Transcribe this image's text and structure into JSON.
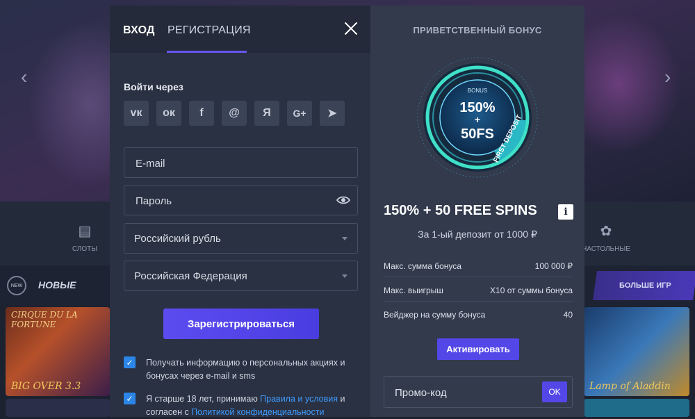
{
  "background": {
    "categories": [
      {
        "label": "СЛОТЫ",
        "icon": "slot-machine-icon"
      },
      {
        "label": "НАСТОЛЬНЫЕ",
        "icon": "poker-chip-icon"
      }
    ],
    "new_badge": "NEW",
    "new_label": "НОВЫЕ",
    "more_games": "БОЛЬШЕ ИГР",
    "game_tiles": [
      {
        "title": "CIRQUE DU LA FORTUNE",
        "bottom": "BIG OVER 3.3"
      },
      {
        "title": "",
        "bottom": "Lamp of Aladdin"
      }
    ]
  },
  "auth": {
    "tabs": [
      {
        "label": "ВХОД",
        "active": false
      },
      {
        "label": "РЕГИСТРАЦИЯ",
        "active": true
      }
    ],
    "login_via": "Войти через",
    "social": [
      {
        "icon": "vk-icon",
        "glyph": "ᴠк"
      },
      {
        "icon": "odnoklassniki-icon",
        "glyph": "ок"
      },
      {
        "icon": "facebook-icon",
        "glyph": "f"
      },
      {
        "icon": "mail-ru-icon",
        "glyph": "@"
      },
      {
        "icon": "yandex-icon",
        "glyph": "Я"
      },
      {
        "icon": "google-plus-icon",
        "glyph": "G+"
      },
      {
        "icon": "telegram-icon",
        "glyph": "➤"
      }
    ],
    "email_placeholder": "E-mail",
    "password_placeholder": "Пароль",
    "currency": "Российский рубль",
    "country": "Российская Федерация",
    "submit": "Зарегистрироваться",
    "consent_promo": {
      "checked": true,
      "text": "Получать информацию о персональных акциях и бонусах через e-mail и sms"
    },
    "consent_age": {
      "checked": true,
      "text_before": "Я старше 18 лет, принимаю ",
      "link1": "Правила и условия",
      "text_middle": " и согласен с ",
      "link2": "Политикой конфиденциальности"
    }
  },
  "bonus": {
    "header": "ПРИВЕТСТВЕННЫЙ БОНУС",
    "wheel": {
      "top": "BONUS",
      "line1": "150%",
      "plus": "+",
      "line2": "50FS",
      "ribbon": "FIRST DEPOSIT"
    },
    "offer_title": "150% + 50 FREE SPINS",
    "info_glyph": "i",
    "offer_sub": "За 1-ый депозит от 1000 ₽",
    "rows": [
      {
        "key": "Макс. сумма бонуса",
        "value": "100 000 ₽"
      },
      {
        "key": "Макс. выигрыш",
        "value": "X10 от суммы бонуса"
      },
      {
        "key": "Вейджер на сумму бонуса",
        "value": "40"
      }
    ],
    "activate": "Активировать",
    "promo_placeholder": "Промо-код",
    "ok": "OK"
  },
  "colors": {
    "accent": "#5447e8",
    "link": "#3e9bff",
    "checkbox": "#2c86e8",
    "teal": "#3fe0c8"
  }
}
